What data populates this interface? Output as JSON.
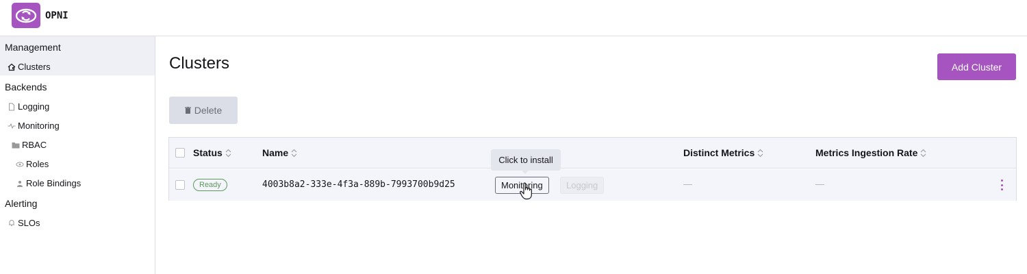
{
  "app": {
    "name": "OPNI",
    "logo_icon": "opni-eye-icon",
    "brand_color": "#a654bf"
  },
  "sidebar": {
    "groups": [
      {
        "label": "Management",
        "items": [
          {
            "label": "Clusters",
            "icon": "home-icon",
            "active": true
          }
        ]
      },
      {
        "label": "Backends",
        "items": [
          {
            "label": "Logging",
            "icon": "file-icon"
          },
          {
            "label": "Monitoring",
            "icon": "pulse-icon"
          },
          {
            "label": "RBAC",
            "icon": "folder-icon"
          },
          {
            "label": "Roles",
            "icon": "eye-icon"
          },
          {
            "label": "Role Bindings",
            "icon": "user-icon"
          }
        ]
      },
      {
        "label": "Alerting",
        "items": [
          {
            "label": "SLOs",
            "icon": "bell-icon"
          }
        ]
      }
    ]
  },
  "main": {
    "title": "Clusters",
    "add_button": "Add Cluster",
    "delete_button": "Delete",
    "table": {
      "columns": [
        "Status",
        "Name",
        "Distinct Metrics",
        "Metrics Ingestion Rate"
      ],
      "rows": [
        {
          "status": "Ready",
          "name": "4003b8a2-333e-4f3a-889b-7993700b9d25",
          "capabilities": [
            "Monitoring",
            "Logging"
          ],
          "distinct_metrics": "—",
          "ingestion_rate": "—"
        }
      ]
    },
    "tooltip": "Click to install"
  },
  "colors": {
    "status_ready": "#5d995d",
    "accent": "#a654bf"
  }
}
